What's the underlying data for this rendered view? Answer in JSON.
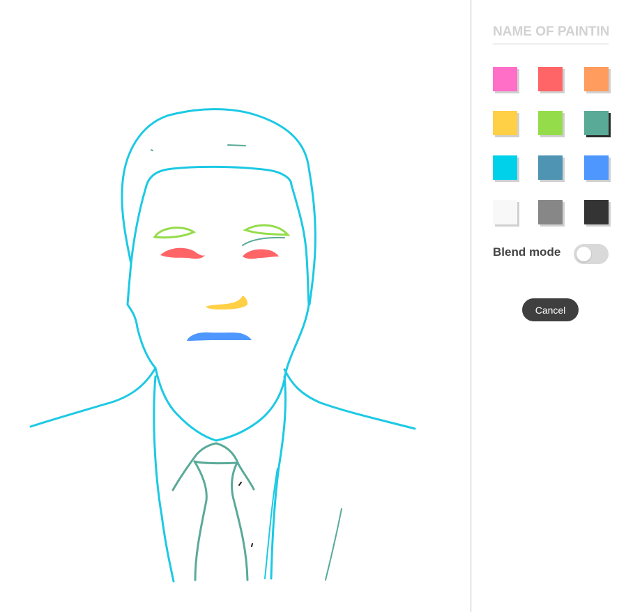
{
  "panel": {
    "name_placeholder": "NAME OF PAINTING",
    "blend_label": "Blend mode",
    "blend_enabled": false,
    "cancel_label": "Cancel",
    "selected_color": "teal",
    "swatches": [
      {
        "name": "pink",
        "color": "#ff6ec7"
      },
      {
        "name": "red",
        "color": "#ff6567"
      },
      {
        "name": "orange",
        "color": "#ff9c5e"
      },
      {
        "name": "yellow",
        "color": "#ffcf45"
      },
      {
        "name": "green",
        "color": "#95dc4b"
      },
      {
        "name": "teal",
        "color": "#5aaa98"
      },
      {
        "name": "cyan",
        "color": "#00d1eb"
      },
      {
        "name": "steel-blue",
        "color": "#5094b4"
      },
      {
        "name": "blue",
        "color": "#4d97ff"
      },
      {
        "name": "white",
        "color": "#f8f8f8"
      },
      {
        "name": "gray",
        "color": "#878787"
      },
      {
        "name": "dark-gray",
        "color": "#343434"
      }
    ]
  },
  "drawing": {
    "stroke_colors": {
      "outline": "#1cc9e4",
      "tie": "#5aaa98",
      "eyebrows": "#95dc4b",
      "eyes": "#ff6567",
      "nose": "#ffcf45",
      "mouth": "#4d97ff",
      "marks": "#222222"
    }
  }
}
